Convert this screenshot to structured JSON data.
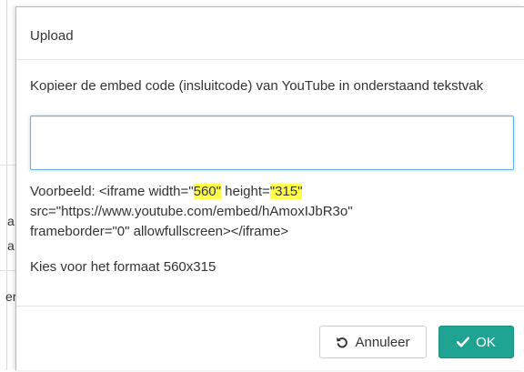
{
  "modal": {
    "title": "Upload",
    "instruction": "Kopieer de embed code (insluitcode) van YouTube  in onderstaand tekstvak",
    "embed_input": {
      "value": "",
      "placeholder": ""
    },
    "example": {
      "prefix": "Voorbeeld: <iframe width=\"",
      "width_value": "560\"",
      "middle": " height=",
      "height_value": "\"315\"",
      "line2": "src=\"https://www.youtube.com/embed/hAmoxIJbR3o\"",
      "line3": "frameborder=\"0\" allowfullscreen></iframe>"
    },
    "format_note": "Kies voor het formaat 560x315"
  },
  "footer": {
    "cancel_label": "Annuleer",
    "ok_label": "OK"
  },
  "background": {
    "fragment_1": "a",
    "fragment_2": "a",
    "fragment_3": "er"
  },
  "colors": {
    "primary": "#1fa393",
    "highlight": "#ffff4a",
    "focus_border": "#66afe9"
  },
  "icons": {
    "cancel": "undo-icon",
    "ok": "check-icon"
  }
}
